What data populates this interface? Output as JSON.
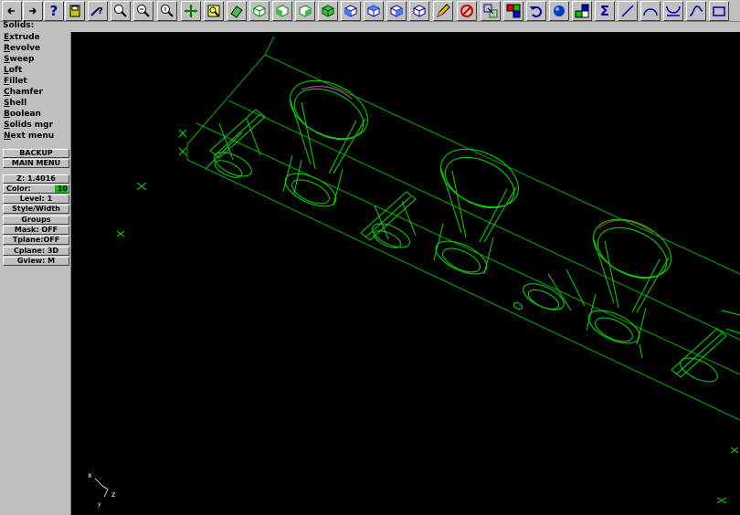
{
  "toolbar": {
    "buttons": [
      {
        "name": "back-arrow-icon"
      },
      {
        "name": "forward-arrow-icon"
      },
      {
        "name": "help-icon",
        "glyph": "?"
      },
      {
        "name": "save-icon"
      },
      {
        "name": "analyze-icon"
      },
      {
        "name": "zoom-window-icon"
      },
      {
        "name": "unzoom-icon"
      },
      {
        "name": "zoom-previous-icon"
      },
      {
        "name": "pan-icon"
      },
      {
        "name": "fit-screen-icon"
      },
      {
        "name": "view-rotate-icon"
      },
      {
        "name": "top-view-icon"
      },
      {
        "name": "front-view-icon"
      },
      {
        "name": "side-view-icon"
      },
      {
        "name": "iso-view-icon"
      },
      {
        "name": "cube-view-1-icon"
      },
      {
        "name": "cube-view-2-icon"
      },
      {
        "name": "cube-view-3-icon"
      },
      {
        "name": "cube-view-4-icon"
      },
      {
        "name": "pencil-icon"
      },
      {
        "name": "delete-icon"
      },
      {
        "name": "transform-icon"
      },
      {
        "name": "color-boxes-icon"
      },
      {
        "name": "undo-icon"
      },
      {
        "name": "shade-sphere-icon"
      },
      {
        "name": "levels-icon"
      },
      {
        "name": "sigma-icon",
        "glyph": "Σ"
      },
      {
        "name": "line-icon"
      },
      {
        "name": "arc-icon"
      },
      {
        "name": "trim-icon"
      },
      {
        "name": "spline-icon"
      },
      {
        "name": "rectangle-icon"
      }
    ]
  },
  "prompt": "Solids:",
  "menu": {
    "items": [
      {
        "label": "Extrude"
      },
      {
        "label": "Revolve"
      },
      {
        "label": "Sweep"
      },
      {
        "label": "Loft"
      },
      {
        "label": "Fillet"
      },
      {
        "label": "Chamfer"
      },
      {
        "label": "Shell"
      },
      {
        "label": "Boolean"
      },
      {
        "label": "Solids mgr"
      },
      {
        "label": "Next menu"
      }
    ],
    "backup": "BACKUP",
    "main_menu": "MAIN MENU"
  },
  "status": {
    "z": "Z:",
    "z_value": "1.4016",
    "color": "Color:",
    "color_value": "10",
    "color_hex": "#00c000",
    "level": "Level:  1",
    "style": "Style/Width",
    "groups": "Groups",
    "mask": "Mask:  OFF",
    "tplane": "Tplane:OFF",
    "cplane": "Cplane: 3D",
    "gview": "Gview:   M"
  },
  "axes": {
    "x": "x",
    "z": "z",
    "y": "y"
  },
  "colors": {
    "wire": "#00dd00",
    "highlight_magenta": "#cc55cc",
    "highlight_red": "#dd4422"
  }
}
